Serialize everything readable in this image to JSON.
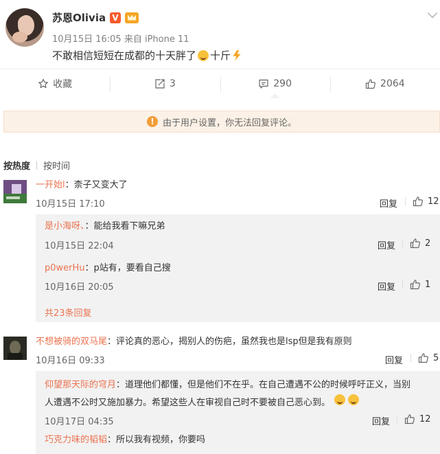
{
  "post": {
    "author": "苏恩Olivia",
    "date": "10月15日 16:05",
    "source_prefix": "来自",
    "source": "iPhone 11",
    "text_before": "不敢相信短短在成都的十天胖了",
    "text_after": "十斤"
  },
  "actions": {
    "favorite_label": "收藏",
    "repost_count": "3",
    "comment_count": "290",
    "like_count": "2064"
  },
  "notice": "由于用户设置，你无法回复评论。",
  "tabs": {
    "hot": "按热度",
    "time": "按时间"
  },
  "reply_label": "回复",
  "comments": [
    {
      "user": "一开始l",
      "text": "：柰子又变大了",
      "time": "10月15日 17:10",
      "likes": "12",
      "replies": [
        {
          "user": "是小海呀、",
          "text": "：能给我看下嘛兄弟",
          "time": "10月15日 22:04",
          "likes": "2"
        },
        {
          "user": "p0werHu",
          "text": "：p站有，要看自己搜",
          "time": "10月16日 20:05",
          "likes": "1"
        }
      ],
      "more_replies": "共23条回复"
    },
    {
      "user": "不想被骑的双马尾",
      "text": "：评论真的恶心，揭别人的伤疤，虽然我也是lsp但是我有原则",
      "time": "10月16日 09:33",
      "likes": "5",
      "replies": [
        {
          "user": "仰望那天际的穹月",
          "text_line1": "：道理他们都懂，但是他们不在乎。在自己遭遇不公的时候呼吁正义，当别",
          "text_line2": "人遭遇不公时又施加暴力。希望这些人在审视自己时不要被自己恶心到。",
          "time": "10月17日 04:35",
          "likes": "12"
        },
        {
          "user": "巧克力味的韬韬",
          "text": "：所以我有视频，你要吗"
        }
      ]
    }
  ],
  "colors": {
    "username": "#eb7350",
    "notice_bg": "#fcf1e6",
    "notice_icon": "#f29d38",
    "badge_v": "#f55a2c"
  }
}
